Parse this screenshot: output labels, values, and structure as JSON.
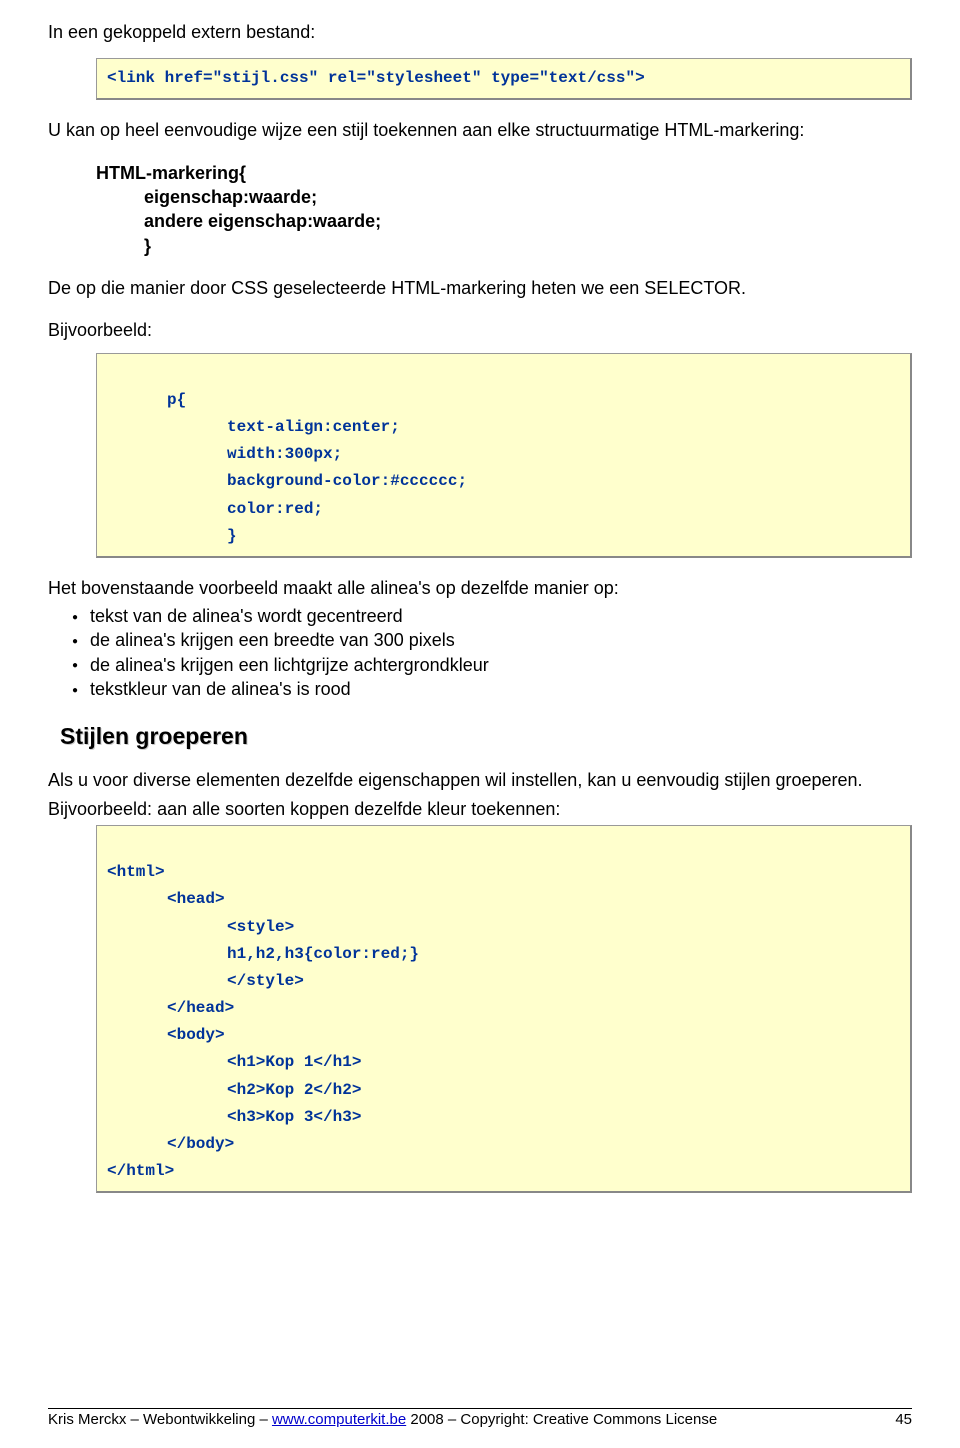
{
  "intro_line": "In een gekoppeld extern bestand:",
  "code1": "<link href=\"stijl.css\" rel=\"stylesheet\" type=\"text/css\">",
  "para2": "U kan op heel eenvoudige wijze een stijl toekennen aan elke structuurmatige HTML-markering:",
  "selector_block": {
    "l1": "HTML-markering{",
    "l2": "eigenschap:waarde;",
    "l3": "andere eigenschap:waarde;",
    "l4": "}"
  },
  "para3": "De op die manier door CSS geselecteerde HTML-markering heten we een SELECTOR.",
  "para4": "Bijvoorbeeld:",
  "code2": {
    "l1": "p{",
    "l2": "text-align:center;",
    "l3": "width:300px;",
    "l4": "background-color:#cccccc;",
    "l5": "color:red;",
    "l6": "}"
  },
  "para5": "Het bovenstaande voorbeeld maakt alle alinea's op dezelfde manier op:",
  "bullets": [
    "tekst van de alinea's wordt gecentreerd",
    "de alinea's krijgen een breedte van 300 pixels",
    "de alinea's krijgen een lichtgrijze achtergrondkleur",
    "tekstkleur van de alinea's is rood"
  ],
  "heading": "Stijlen groeperen",
  "para6": "Als u voor diverse elementen dezelfde eigenschappen wil instellen, kan u eenvoudig stijlen groeperen.",
  "para7": "Bijvoorbeeld: aan alle soorten koppen dezelfde kleur toekennen:",
  "code3": {
    "l1": "<html>",
    "l2": "<head>",
    "l3": "<style>",
    "l4": "h1,h2,h3{color:red;}",
    "l5": "</style>",
    "l6": "</head>",
    "l7": "<body>",
    "l8": "<h1>Kop 1</h1>",
    "l9": "<h2>Kop 2</h2>",
    "l10": "<h3>Kop 3</h3>",
    "l11": "</body>",
    "l12": "</html>"
  },
  "footer": {
    "left_pre": "Kris Merckx – Webontwikkeling – ",
    "link": "www.computerkit.be",
    "left_post": " 2008 – Copyright: Creative Commons License",
    "page": "45"
  }
}
